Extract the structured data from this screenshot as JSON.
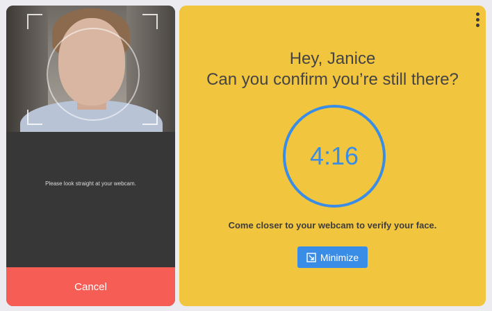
{
  "webcam_panel": {
    "instruction": "Please look straight at your webcam.",
    "cancel_label": "Cancel"
  },
  "main_panel": {
    "greeting": "Hey, Janice",
    "question": "Can you confirm you’re still there?",
    "timer": "4:16",
    "hint": "Come closer to your webcam to verify your face.",
    "minimize_label": "Minimize",
    "minimize_icon": "minimize-arrow-icon",
    "menu_icon": "more-vertical-icon"
  },
  "colors": {
    "accent": "#3a8de6",
    "panel_bg": "#f2c53e",
    "cancel_bg": "#f65e55",
    "webcam_bg": "#373737"
  }
}
